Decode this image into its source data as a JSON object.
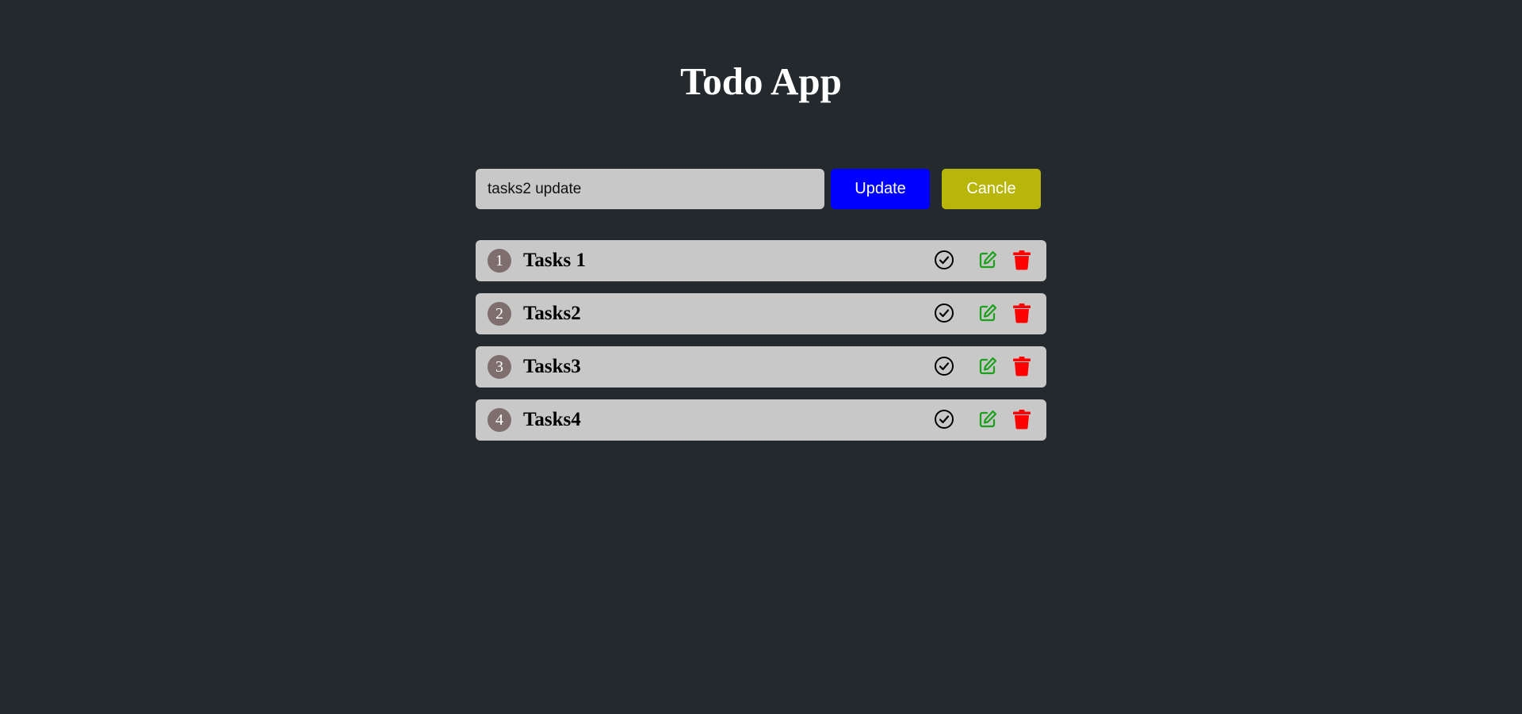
{
  "app": {
    "title": "Todo App"
  },
  "form": {
    "input_value": "tasks2 update",
    "update_label": "Update",
    "cancel_label": "Cancle"
  },
  "tasks": [
    {
      "number": "1",
      "text": "Tasks 1"
    },
    {
      "number": "2",
      "text": "Tasks2"
    },
    {
      "number": "3",
      "text": "Tasks3"
    },
    {
      "number": "4",
      "text": "Tasks4"
    }
  ],
  "icons": {
    "complete": "check-circle-icon",
    "edit": "edit-icon",
    "delete": "trash-icon"
  },
  "colors": {
    "background": "#23292d",
    "row_background": "#c8c8c8",
    "update_button": "#0000ff",
    "cancel_button": "#b8b50b",
    "edit_icon": "#1aa01a",
    "delete_icon": "#ff0000",
    "number_badge": "#7e6e6e"
  }
}
